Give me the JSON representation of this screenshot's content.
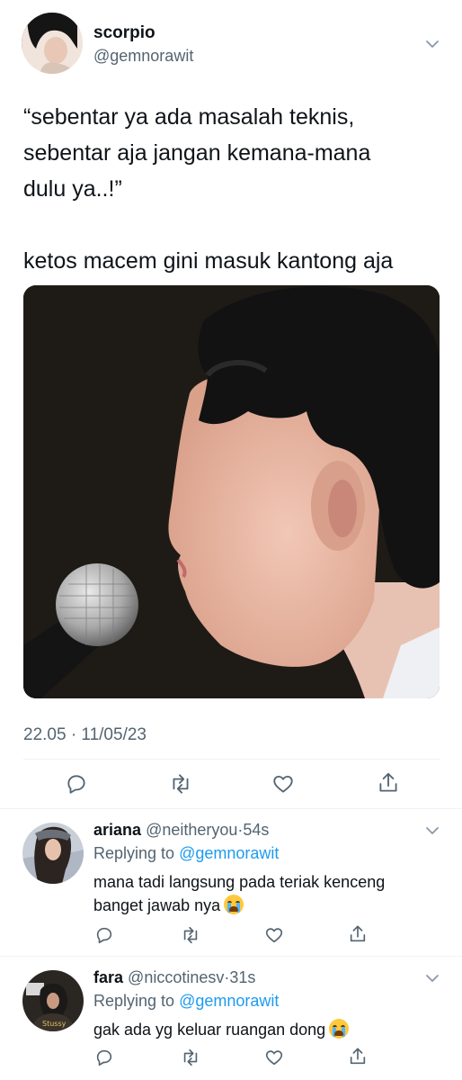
{
  "tweet": {
    "display_name": "scorpio",
    "handle": "@gemnorawit",
    "text_line1": "“sebentar ya ada masalah teknis,",
    "text_line2": "sebentar aja jangan kemana-mana",
    "text_line3": "dulu ya..!”",
    "text_line4": "ketos macem gini masuk kantong aja",
    "timestamp": "22.05 · 11/05/23",
    "media_alt": "side-profile photo of a man with dark hair in front of a microphone"
  },
  "replies": [
    {
      "display_name": "ariana",
      "handle": "@neitheryou",
      "time": "54s",
      "replying_label": "Replying to",
      "replying_handle": "@gemnorawit",
      "line1": "mana tadi langsung pada teriak kenceng",
      "line2": "banget jawab nya",
      "emoji": "loudly-crying-face"
    },
    {
      "display_name": "fara",
      "handle": "@niccotinesv",
      "time": "31s",
      "replying_label": "Replying to",
      "replying_handle": "@gemnorawit",
      "line1": "gak ada yg keluar ruangan dong",
      "emoji": "loudly-crying-face"
    }
  ],
  "colors": {
    "text": "#0f1419",
    "secondary": "#536471",
    "link": "#1d9bf0",
    "divider": "#eff3f4"
  }
}
